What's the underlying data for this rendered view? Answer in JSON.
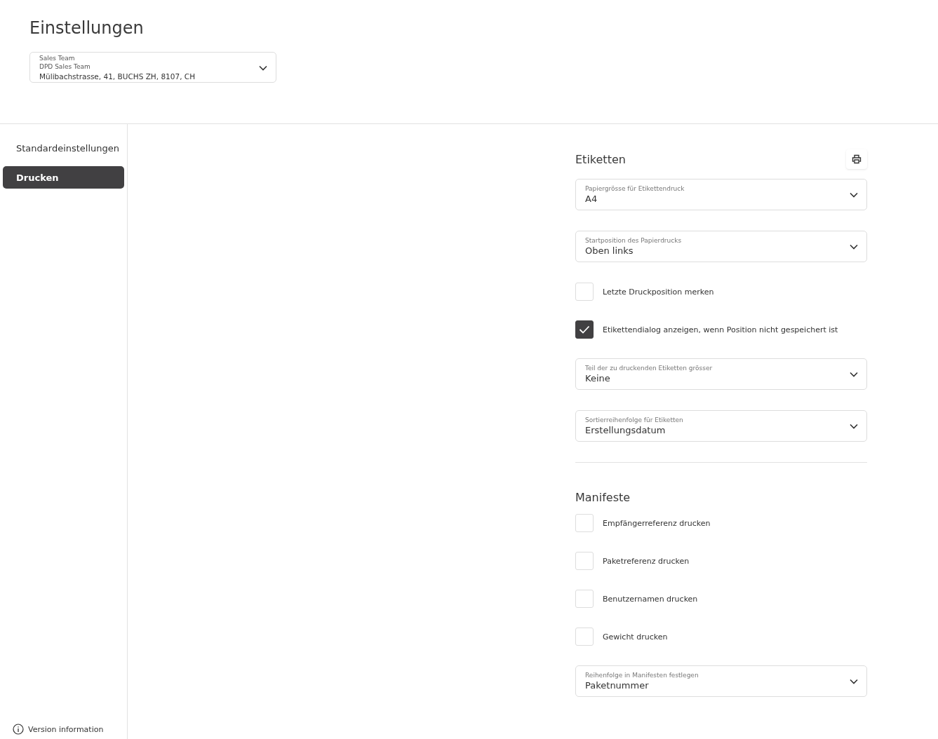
{
  "page_title": "Einstellungen",
  "account_select": {
    "label": "Sales Team",
    "name": "DPD Sales Team",
    "address": "Mülibachstrasse, 41, BUCHS ZH, 8107, CH"
  },
  "sidebar": {
    "items": [
      {
        "label": "Standardeinstellungen",
        "selected": false
      },
      {
        "label": "Drucken",
        "selected": true
      }
    ],
    "footer": "Version information"
  },
  "sections": [
    {
      "title": "Etiketten",
      "print_button": true,
      "items": [
        {
          "kind": "select",
          "label": "Papiergrösse für Etikettendruck",
          "value": "A4"
        },
        {
          "kind": "select",
          "label": "Startposition des Papierdrucks",
          "value": "Oben links"
        },
        {
          "kind": "checkbox",
          "label": "Letzte Druckposition merken",
          "checked": false
        },
        {
          "kind": "checkbox",
          "label": "Etikettendialog anzeigen, wenn Position nicht gespeichert ist",
          "checked": true
        },
        {
          "kind": "select",
          "label": "Teil der zu druckenden Etiketten grösser",
          "value": "Keine"
        },
        {
          "kind": "select",
          "label": "Sortierreihenfolge für Etiketten",
          "value": "Erstellungsdatum"
        }
      ]
    },
    {
      "title": "Manifeste",
      "print_button": false,
      "items": [
        {
          "kind": "checkbox",
          "label": "Empfängerreferenz drucken",
          "checked": false
        },
        {
          "kind": "checkbox",
          "label": "Paketreferenz drucken",
          "checked": false
        },
        {
          "kind": "checkbox",
          "label": "Benutzernamen drucken",
          "checked": false
        },
        {
          "kind": "checkbox",
          "label": "Gewicht drucken",
          "checked": false
        },
        {
          "kind": "select",
          "label": "Reihenfolge in Manifesten festlegen",
          "value": "Paketnummer"
        }
      ]
    }
  ]
}
